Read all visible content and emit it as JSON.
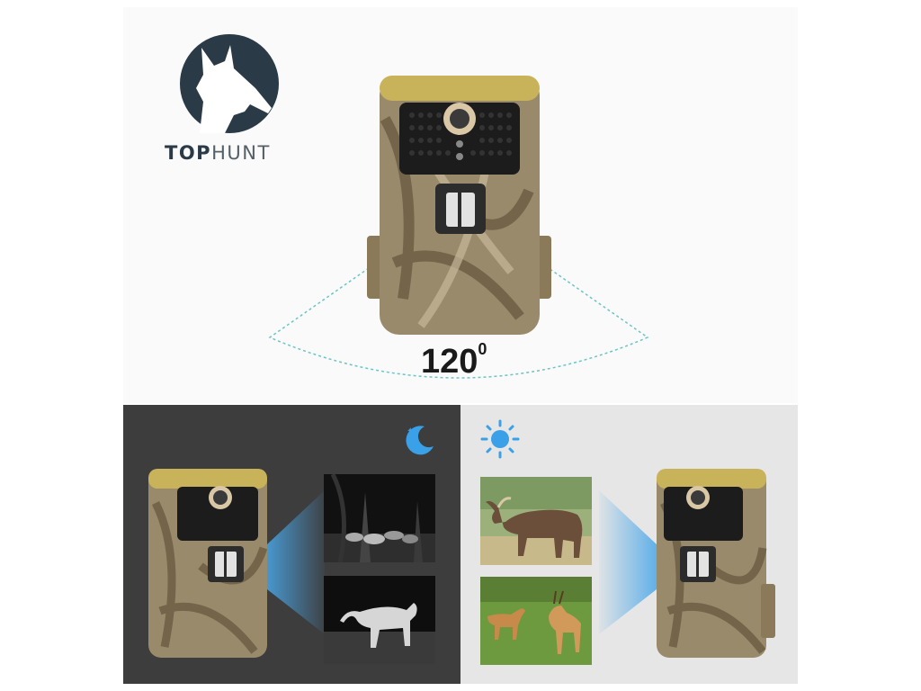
{
  "brand": {
    "name_bold": "TOP",
    "name_rest": "HUNT"
  },
  "camera": {
    "field_of_view_value": "120",
    "field_of_view_unit": "0"
  },
  "night_mode": {
    "icon": "moon-stars-icon",
    "photos": [
      "night-deer-herd-photo",
      "night-lioness-photo"
    ]
  },
  "day_mode": {
    "icon": "sun-icon",
    "photos": [
      "day-buffalo-photo",
      "day-gazelles-photo"
    ]
  },
  "colors": {
    "accent_blue": "#3aa0e8",
    "logo_navy": "#2a3a46",
    "night_bg": "#3d3d3d",
    "day_bg": "#e6e6e6"
  }
}
